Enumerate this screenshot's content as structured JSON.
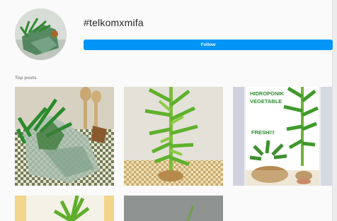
{
  "header": {
    "hashtag": "#telkomxmifa",
    "follow_label": "Follow"
  },
  "sections": {
    "top_posts_label": "Top posts"
  },
  "posts": [
    {
      "id": "post-1",
      "kind": "bagged-vegetable-on-checkered-cloth"
    },
    {
      "id": "post-2",
      "kind": "hydroponic-plant"
    },
    {
      "id": "post-3",
      "kind": "hydroponic-ad",
      "line1": "HIDROPONIK",
      "line2": "VEGETABLE",
      "line3": "FRESH!!!"
    },
    {
      "id": "post-4",
      "kind": "plant-yellow-background"
    },
    {
      "id": "post-5",
      "kind": "plant-grey-background"
    }
  ],
  "colors": {
    "follow_button": "#0095f6",
    "ad_text": "#2c8c2c"
  }
}
